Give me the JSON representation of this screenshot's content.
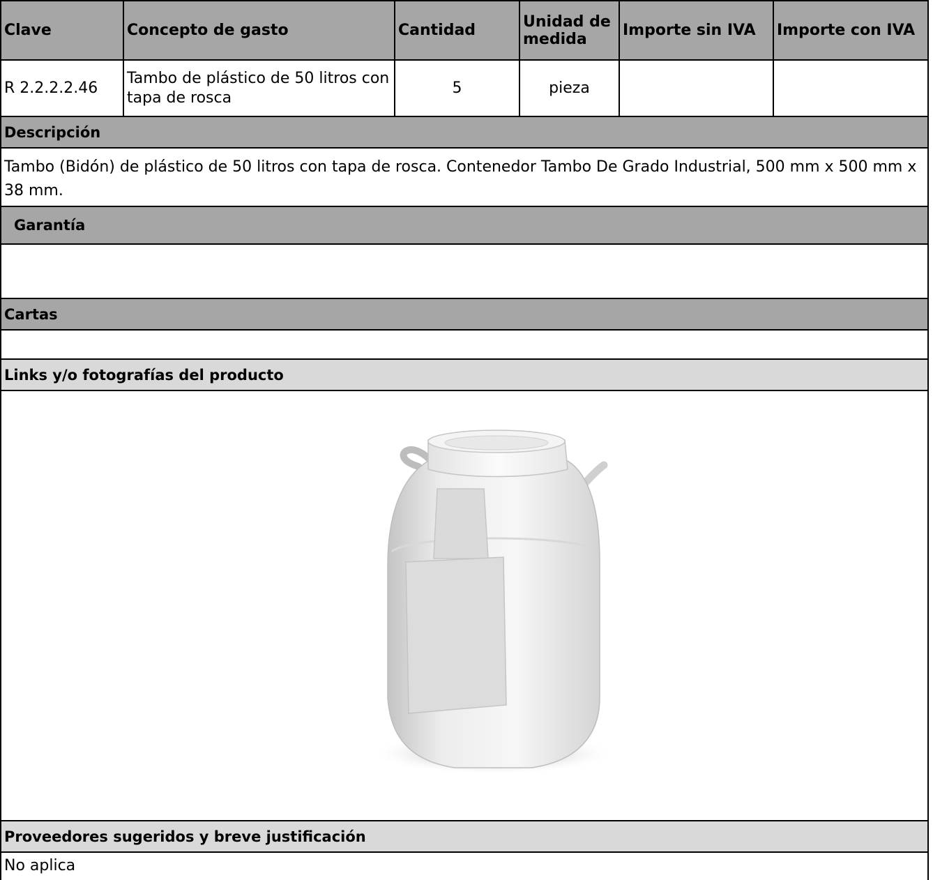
{
  "table": {
    "headers": [
      "Clave",
      "Concepto de gasto",
      "Cantidad",
      "Unidad de medida",
      "Importe sin IVA",
      "Importe con IVA"
    ],
    "row": {
      "clave": "R 2.2.2.2.46",
      "concepto": "Tambo de plástico de 50 litros con tapa de rosca",
      "cantidad": "5",
      "unidad": "pieza",
      "importe_sin_iva": "",
      "importe_con_iva": ""
    }
  },
  "sections": {
    "descripcion": {
      "title": "Descripción",
      "body": "Tambo (Bidón) de plástico de 50 litros con tapa de rosca. Contenedor Tambo De Grado Industrial, 500 mm x 500 mm x 38 mm."
    },
    "garantia": {
      "title": "Garantía",
      "body": ""
    },
    "cartas": {
      "title": "Cartas",
      "body": ""
    },
    "links": {
      "title": "Links y/o fotografías del producto"
    },
    "proveedores": {
      "title": "Proveedores sugeridos y breve justificación",
      "body": "No aplica"
    }
  },
  "colors": {
    "header_dark": "#a6a6a6",
    "header_light": "#d9d9d9",
    "border": "#000000"
  }
}
